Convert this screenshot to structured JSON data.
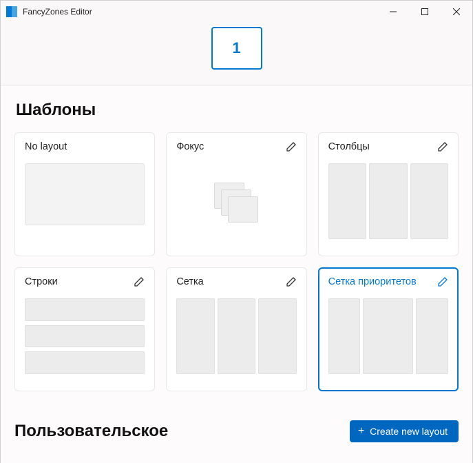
{
  "window": {
    "title": "FancyZones Editor"
  },
  "header": {
    "zone_number": "1"
  },
  "sections": {
    "templates_title": "Шаблоны",
    "custom_title": "Пользовательское"
  },
  "templates": {
    "no_layout": {
      "label": "No layout"
    },
    "focus": {
      "label": "Фокус"
    },
    "columns": {
      "label": "Столбцы"
    },
    "rows": {
      "label": "Строки"
    },
    "grid": {
      "label": "Сетка"
    },
    "priority": {
      "label": "Сетка приоритетов",
      "selected": true
    }
  },
  "actions": {
    "create_layout": "Create new layout"
  }
}
